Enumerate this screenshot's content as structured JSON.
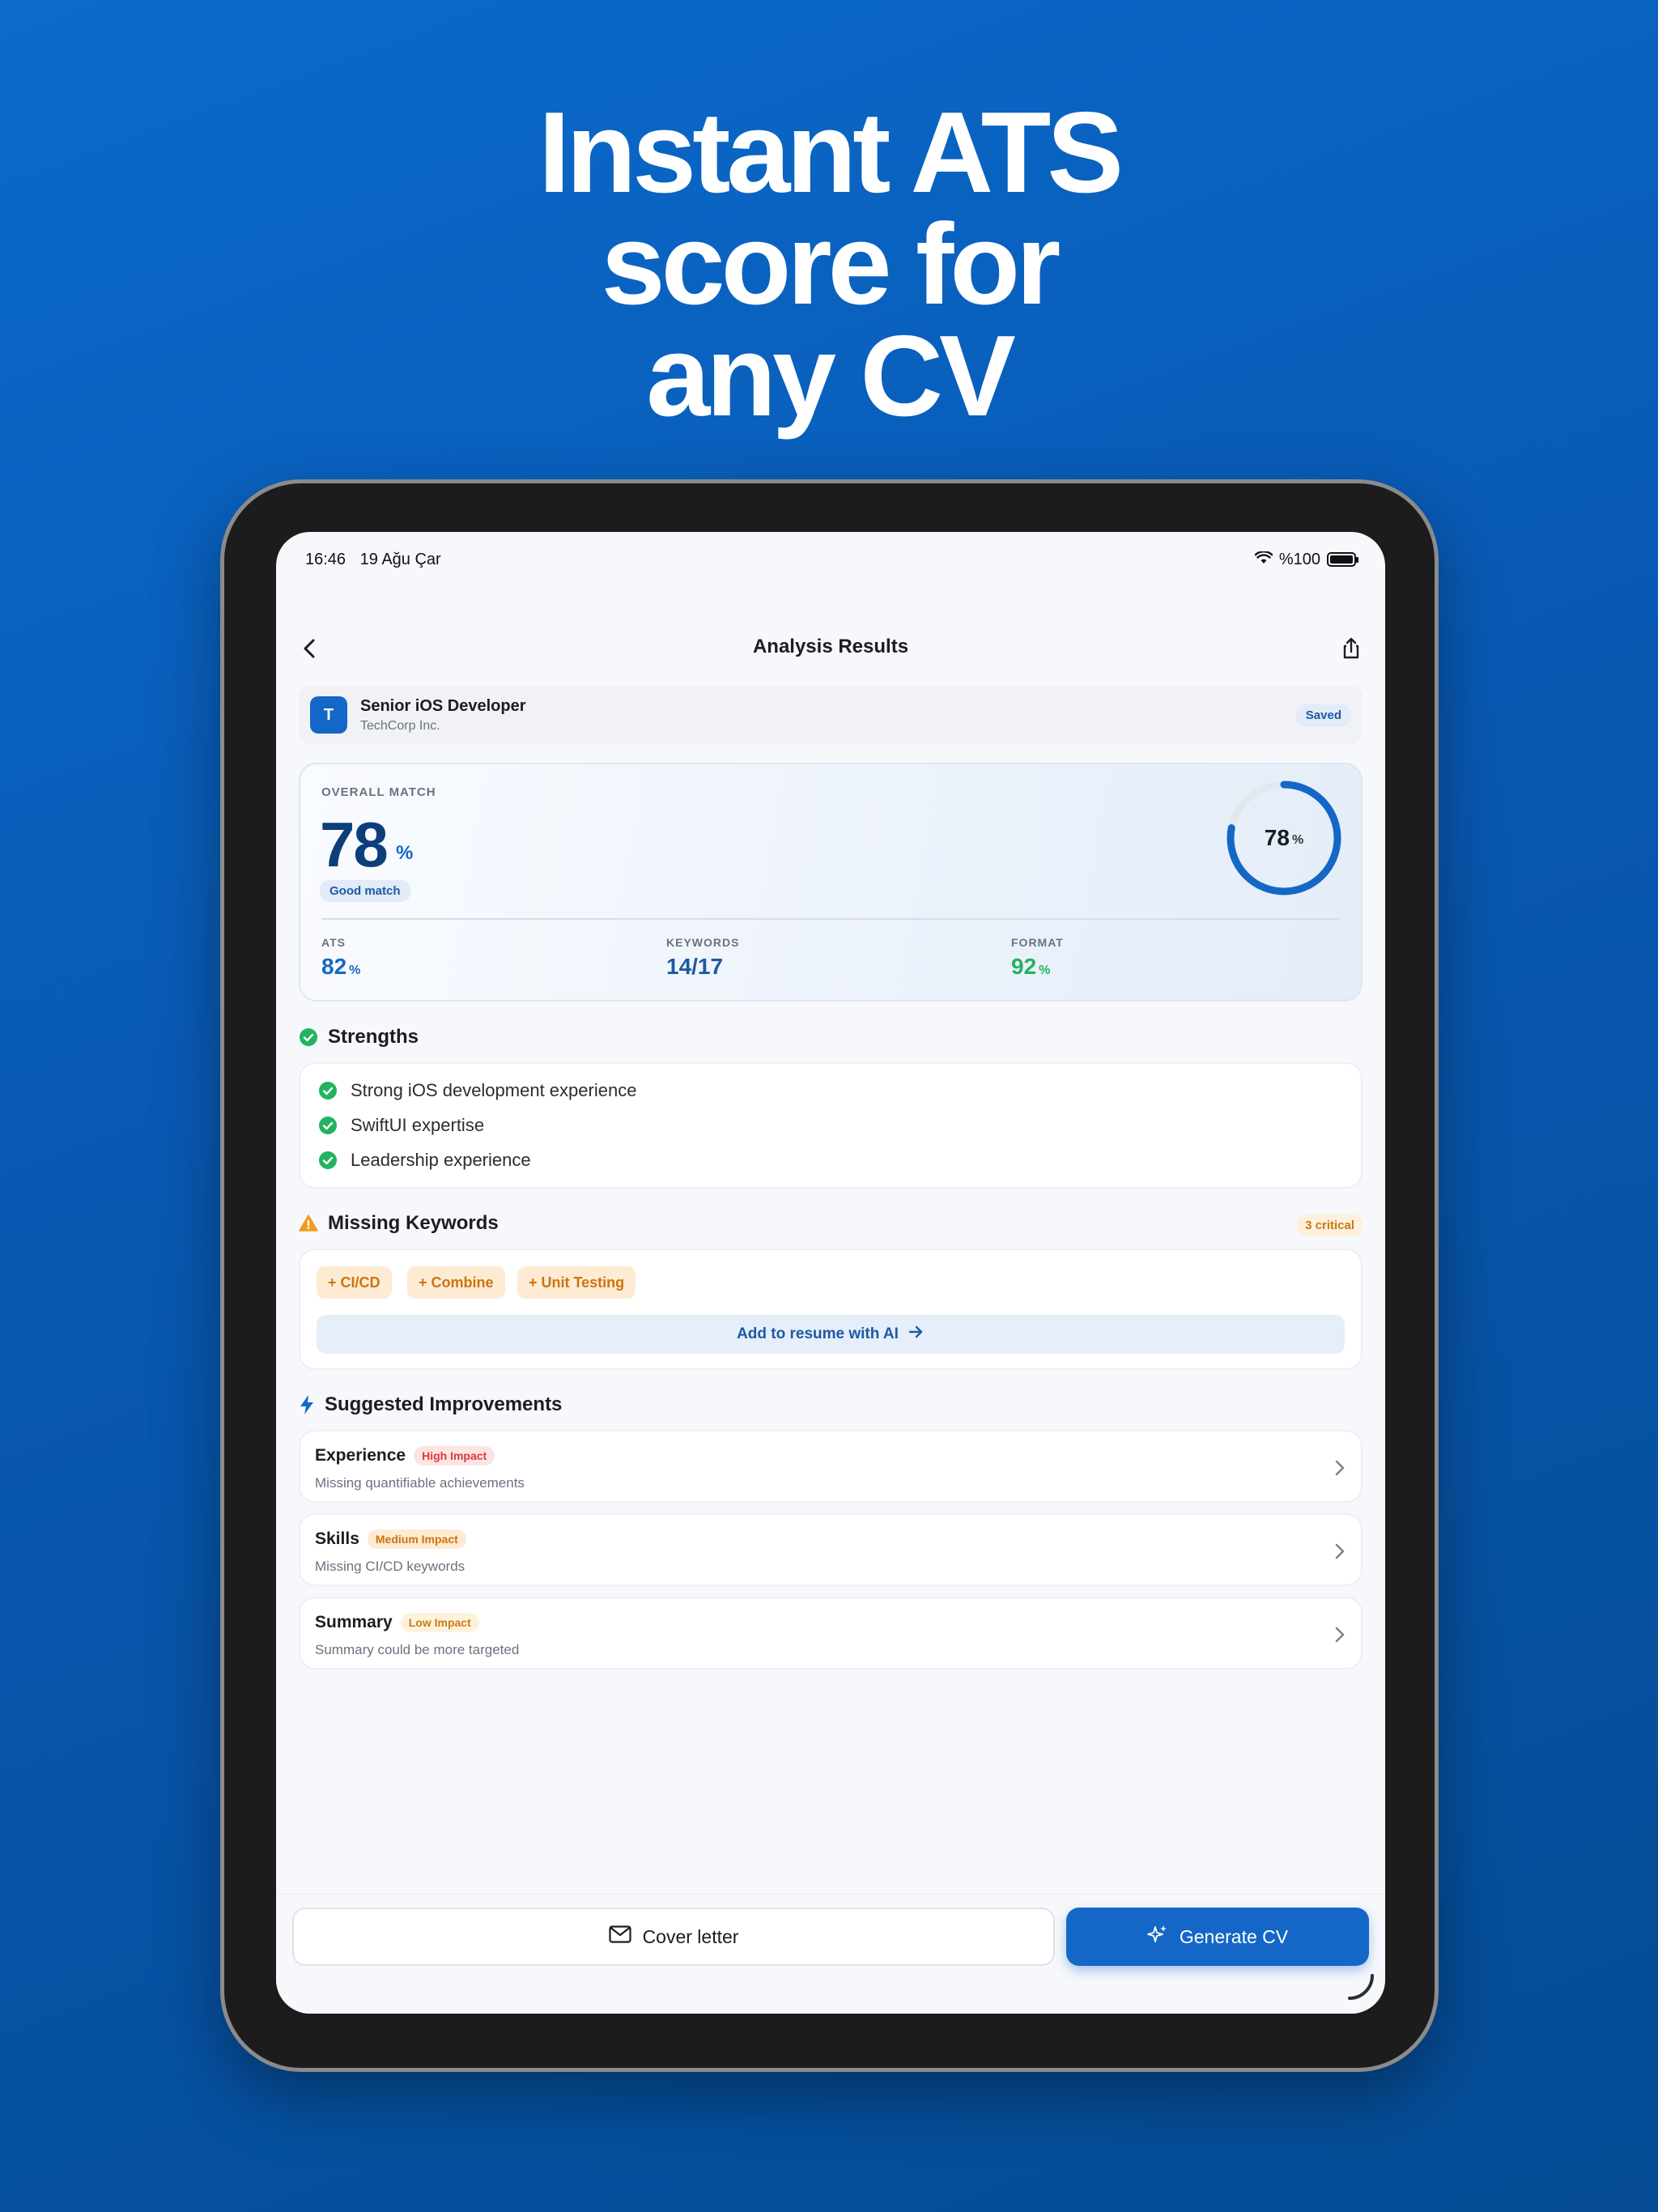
{
  "headline": [
    "Instant ATS",
    "score for",
    "any CV"
  ],
  "status_bar": {
    "time": "16:46",
    "date": "19 Ağu Çar",
    "battery": "%100"
  },
  "nav": {
    "title": "Analysis Results"
  },
  "job": {
    "avatar_letter": "T",
    "title": "Senior iOS Developer",
    "company": "TechCorp Inc.",
    "saved_label": "Saved"
  },
  "overall": {
    "label": "OVERALL MATCH",
    "value": "78",
    "pct": "%",
    "rating": "Good match",
    "ring_value": "78",
    "ring_fraction": 0.78
  },
  "metrics": [
    {
      "label": "ATS",
      "value": "82",
      "unit": "%",
      "color": "#1467c6"
    },
    {
      "label": "KEYWORDS",
      "value": "14/17",
      "unit": "",
      "color": "#1d5aa2"
    },
    {
      "label": "FORMAT",
      "value": "92",
      "unit": "%",
      "color": "#22b35e"
    }
  ],
  "strengths": {
    "title": "Strengths",
    "items": [
      "Strong iOS development experience",
      "SwiftUI expertise",
      "Leadership experience"
    ]
  },
  "missing": {
    "title": "Missing Keywords",
    "critical_badge": "3 critical",
    "chips": [
      "+ CI/CD",
      "+ Combine",
      "+ Unit Testing"
    ],
    "ai_button": "Add to resume with AI"
  },
  "improvements": {
    "title": "Suggested Improvements",
    "items": [
      {
        "title": "Experience",
        "badge": "High Impact",
        "badge_color": "#d93b3b",
        "badge_bg": "#fde4e4",
        "desc": "Missing quantifiable achievements"
      },
      {
        "title": "Skills",
        "badge": "Medium Impact",
        "badge_color": "#cc7312",
        "badge_bg": "#fdebd3",
        "desc": "Missing CI/CD keywords"
      },
      {
        "title": "Summary",
        "badge": "Low Impact",
        "badge_color": "#c77b13",
        "badge_bg": "#fdf3dc",
        "desc": "Summary could be more targeted"
      }
    ]
  },
  "actions": {
    "cover_letter": "Cover letter",
    "generate": "Generate CV"
  },
  "colors": {
    "accent": "#1467c6",
    "success": "#22b35e",
    "warning": "#f29b1b"
  }
}
